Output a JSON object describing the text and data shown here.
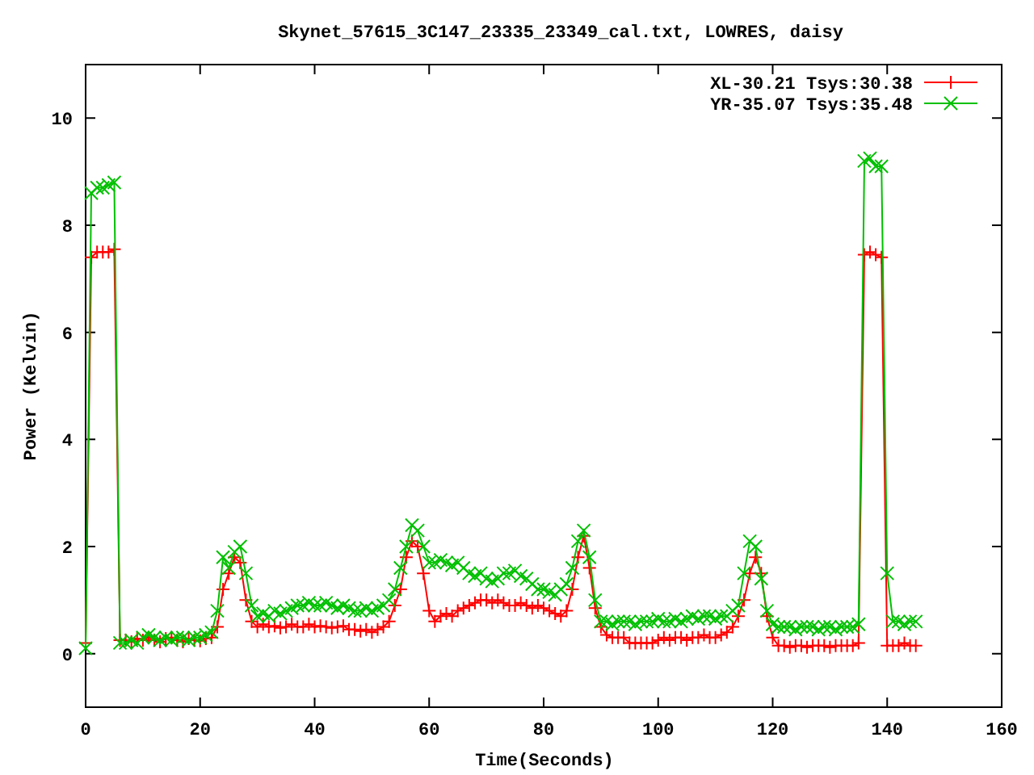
{
  "chart_data": {
    "type": "line",
    "title": "Skynet_57615_3C147_23335_23349_cal.txt, LOWRES, daisy",
    "xlabel": "Time(Seconds)",
    "ylabel": "Power (Kelvin)",
    "x": [
      0,
      1,
      2,
      3,
      4,
      5,
      6,
      7,
      8,
      9,
      10,
      11,
      12,
      13,
      14,
      15,
      16,
      17,
      18,
      19,
      20,
      21,
      22,
      23,
      24,
      25,
      26,
      27,
      28,
      29,
      30,
      31,
      32,
      33,
      34,
      35,
      36,
      37,
      38,
      39,
      40,
      41,
      42,
      43,
      44,
      45,
      46,
      47,
      48,
      49,
      50,
      51,
      52,
      53,
      54,
      55,
      56,
      57,
      58,
      59,
      60,
      61,
      62,
      63,
      64,
      65,
      66,
      67,
      68,
      69,
      70,
      71,
      72,
      73,
      74,
      75,
      76,
      77,
      78,
      79,
      80,
      81,
      82,
      83,
      84,
      85,
      86,
      87,
      88,
      89,
      90,
      91,
      92,
      93,
      94,
      95,
      96,
      97,
      98,
      99,
      100,
      101,
      102,
      103,
      104,
      105,
      106,
      107,
      108,
      109,
      110,
      111,
      112,
      113,
      114,
      115,
      116,
      117,
      118,
      119,
      120,
      121,
      122,
      123,
      124,
      125,
      126,
      127,
      128,
      129,
      130,
      131,
      132,
      133,
      134,
      135,
      136,
      137,
      138,
      139,
      140,
      141,
      142,
      143,
      144,
      145
    ],
    "series": [
      {
        "name": "XL-30.21 Tsys:30.38",
        "color": "#ff0000",
        "marker": "plus",
        "values": [
          0.2,
          7.4,
          7.5,
          7.5,
          7.5,
          7.55,
          0.25,
          0.25,
          0.22,
          0.28,
          0.25,
          0.3,
          0.25,
          0.22,
          0.28,
          0.3,
          0.25,
          0.22,
          0.28,
          0.25,
          0.24,
          0.28,
          0.3,
          0.5,
          1.2,
          1.5,
          1.8,
          1.7,
          1.0,
          0.6,
          0.5,
          0.55,
          0.5,
          0.52,
          0.48,
          0.5,
          0.55,
          0.5,
          0.5,
          0.55,
          0.5,
          0.52,
          0.5,
          0.48,
          0.5,
          0.52,
          0.45,
          0.45,
          0.42,
          0.45,
          0.4,
          0.45,
          0.5,
          0.6,
          0.9,
          1.2,
          1.8,
          2.1,
          2.0,
          1.5,
          0.8,
          0.6,
          0.7,
          0.75,
          0.7,
          0.8,
          0.85,
          0.9,
          0.95,
          1.0,
          1.0,
          0.95,
          1.0,
          0.95,
          0.9,
          0.9,
          0.95,
          0.9,
          0.85,
          0.9,
          0.85,
          0.8,
          0.75,
          0.7,
          0.8,
          1.2,
          1.8,
          2.2,
          1.6,
          0.85,
          0.5,
          0.35,
          0.3,
          0.3,
          0.3,
          0.2,
          0.2,
          0.2,
          0.2,
          0.2,
          0.25,
          0.3,
          0.25,
          0.3,
          0.3,
          0.25,
          0.3,
          0.3,
          0.35,
          0.3,
          0.3,
          0.35,
          0.4,
          0.5,
          0.7,
          1.0,
          1.5,
          1.8,
          1.5,
          0.7,
          0.3,
          0.15,
          0.15,
          0.12,
          0.15,
          0.15,
          0.12,
          0.15,
          0.15,
          0.15,
          0.12,
          0.15,
          0.15,
          0.15,
          0.15,
          0.2,
          7.45,
          7.5,
          7.45,
          7.4,
          0.15,
          0.15,
          0.15,
          0.2,
          0.15,
          0.15
        ]
      },
      {
        "name": "YR-35.07 Tsys:35.48",
        "color": "#00c000",
        "marker": "cross",
        "values": [
          0.1,
          8.6,
          8.7,
          8.7,
          8.75,
          8.8,
          0.2,
          0.2,
          0.25,
          0.2,
          0.3,
          0.35,
          0.3,
          0.25,
          0.3,
          0.25,
          0.3,
          0.3,
          0.25,
          0.3,
          0.3,
          0.35,
          0.4,
          0.8,
          1.8,
          1.6,
          1.9,
          2.0,
          1.5,
          0.9,
          0.7,
          0.75,
          0.7,
          0.8,
          0.75,
          0.8,
          0.85,
          0.9,
          0.9,
          0.95,
          0.9,
          0.9,
          0.95,
          0.9,
          0.85,
          0.9,
          0.85,
          0.8,
          0.8,
          0.85,
          0.8,
          0.85,
          0.9,
          1.0,
          1.2,
          1.6,
          2.0,
          2.4,
          2.3,
          2.0,
          1.7,
          1.7,
          1.75,
          1.7,
          1.65,
          1.7,
          1.6,
          1.5,
          1.45,
          1.5,
          1.4,
          1.35,
          1.4,
          1.5,
          1.5,
          1.55,
          1.45,
          1.4,
          1.3,
          1.2,
          1.2,
          1.15,
          1.1,
          1.2,
          1.3,
          1.6,
          2.1,
          2.3,
          1.8,
          1.0,
          0.6,
          0.6,
          0.55,
          0.6,
          0.6,
          0.6,
          0.55,
          0.6,
          0.6,
          0.6,
          0.65,
          0.6,
          0.6,
          0.65,
          0.6,
          0.65,
          0.7,
          0.65,
          0.7,
          0.7,
          0.65,
          0.7,
          0.7,
          0.8,
          0.9,
          1.5,
          2.1,
          2.0,
          1.4,
          0.8,
          0.55,
          0.5,
          0.5,
          0.5,
          0.45,
          0.5,
          0.5,
          0.5,
          0.45,
          0.5,
          0.5,
          0.45,
          0.5,
          0.5,
          0.5,
          0.55,
          9.2,
          9.25,
          9.1,
          9.1,
          1.5,
          0.6,
          0.6,
          0.55,
          0.6,
          0.6
        ]
      }
    ],
    "legend": true,
    "xlim": [
      0,
      160
    ],
    "ylim": [
      -1,
      11
    ],
    "xticks": [
      0,
      20,
      40,
      60,
      80,
      100,
      120,
      140,
      160
    ],
    "yticks": [
      0,
      2,
      4,
      6,
      8,
      10
    ]
  }
}
